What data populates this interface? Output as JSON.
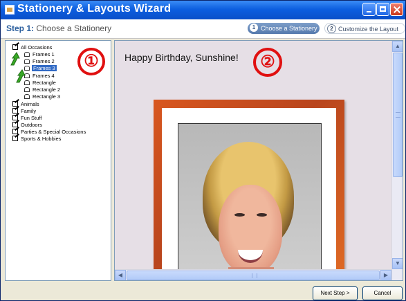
{
  "window": {
    "title": "Stationery & Layouts Wizard"
  },
  "stepbar": {
    "step_prefix": "Step 1:",
    "step_text": " Choose a Stationery",
    "steps": [
      {
        "number": "1",
        "label": "Choose a Stationery",
        "state": "active"
      },
      {
        "number": "2",
        "label": "Customize the Layout",
        "state": "inactive"
      }
    ]
  },
  "tree": {
    "items": [
      {
        "label": "All Occasions",
        "type": "category"
      },
      {
        "label": "Frames 1",
        "type": "item"
      },
      {
        "label": "Frames 2",
        "type": "item"
      },
      {
        "label": "Frames 3",
        "type": "item",
        "selected": true
      },
      {
        "label": "Frames 4",
        "type": "item"
      },
      {
        "label": "Rectangle",
        "type": "item"
      },
      {
        "label": "Rectangle 2",
        "type": "item"
      },
      {
        "label": "Rectangle 3",
        "type": "item"
      },
      {
        "label": "Animals",
        "type": "category"
      },
      {
        "label": "Family",
        "type": "category"
      },
      {
        "label": "Fun Stuff",
        "type": "category"
      },
      {
        "label": "Outdoors",
        "type": "category"
      },
      {
        "label": "Parties & Special Occasions",
        "type": "category"
      },
      {
        "label": "Sports & Hobbies",
        "type": "category"
      }
    ]
  },
  "annotations": {
    "marker_1": "①",
    "marker_2": "②"
  },
  "preview": {
    "greeting": "Happy Birthday, Sunshine!",
    "scroll_up": "▲",
    "scroll_down": "▼",
    "scroll_left": "◀",
    "scroll_right": "▶"
  },
  "buttons": {
    "next": "Next Step >",
    "cancel": "Cancel"
  },
  "colors": {
    "title_gradient": "#0d5fe0",
    "frame": "#c24c1f",
    "selection": "#316ac5",
    "annotation": "#e01010"
  }
}
